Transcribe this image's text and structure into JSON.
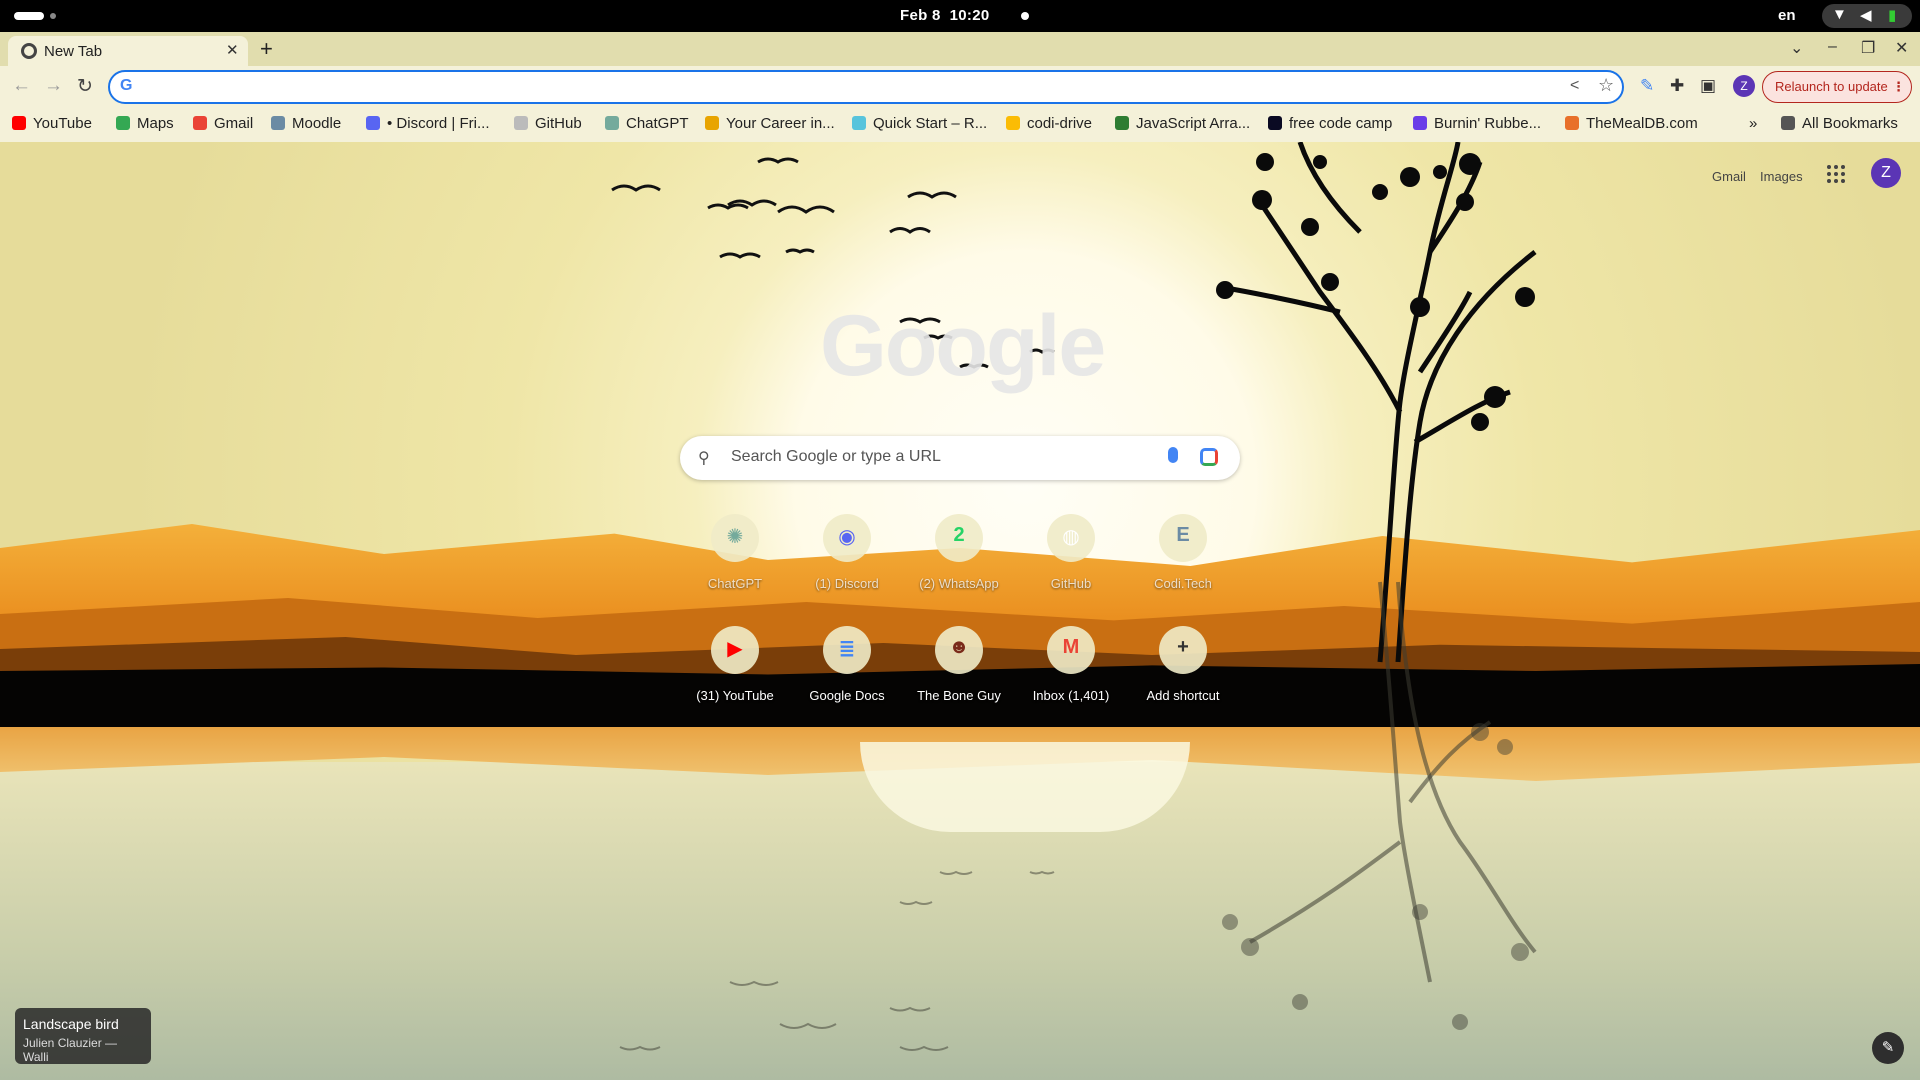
{
  "os": {
    "date": "Feb 8",
    "time": "10:20",
    "language": "en"
  },
  "browser": {
    "tab_title": "New Tab",
    "omnibox_value": "",
    "relaunch_label": "Relaunch to update",
    "profile_initial": "Z",
    "bookmarks": [
      {
        "label": "YouTube",
        "color": "#ff0000"
      },
      {
        "label": "Maps",
        "color": "#34a853"
      },
      {
        "label": "Gmail",
        "color": "#ea4335"
      },
      {
        "label": "Moodle",
        "color": "#6b8ba4"
      },
      {
        "label": "• Discord | Fri...",
        "color": "#5865f2"
      },
      {
        "label": "GitHub",
        "color": "#bbbbbb"
      },
      {
        "label": "ChatGPT",
        "color": "#74aa9c"
      },
      {
        "label": "Your Career in...",
        "color": "#e8a400"
      },
      {
        "label": "Quick Start – R...",
        "color": "#58c4dc"
      },
      {
        "label": "codi-drive",
        "color": "#fbbc04"
      },
      {
        "label": "JavaScript Arra...",
        "color": "#2e7d32"
      },
      {
        "label": "free code camp",
        "color": "#0a0a23"
      },
      {
        "label": "Burnin' Rubbe...",
        "color": "#6a3de8"
      },
      {
        "label": "TheMealDB.com",
        "color": "#e8702a"
      }
    ],
    "all_bookmarks_label": "All Bookmarks"
  },
  "ntp": {
    "gmail_link": "Gmail",
    "images_link": "Images",
    "profile_initial": "Z",
    "logo_text": "Google",
    "search_placeholder": "Search Google or type a URL",
    "shortcuts_row1": [
      {
        "label": "ChatGPT",
        "glyph": "✺",
        "color": "#74aa9c"
      },
      {
        "label": "(1) Discord",
        "glyph": "◉",
        "color": "#5865f2"
      },
      {
        "label": "(2) WhatsApp",
        "glyph": "2",
        "color": "#25d366"
      },
      {
        "label": "GitHub",
        "glyph": "◍",
        "color": "#ffffff"
      },
      {
        "label": "Codi.Tech",
        "glyph": "E",
        "color": "#6b8ba4"
      }
    ],
    "shortcuts_row2": [
      {
        "label": "(31) YouTube",
        "glyph": "▶",
        "color": "#ff0000"
      },
      {
        "label": "Google Docs",
        "glyph": "≣",
        "color": "#4285f4"
      },
      {
        "label": "The Bone Guy",
        "glyph": "☻",
        "color": "#7a2a1a"
      },
      {
        "label": "Inbox (1,401)",
        "glyph": "M",
        "color": "#ea4335"
      },
      {
        "label": "Add shortcut",
        "glyph": "+",
        "color": "#333333"
      }
    ],
    "attribution_title": "Landscape bird",
    "attribution_author": "Julien Clauzier — Walli"
  }
}
